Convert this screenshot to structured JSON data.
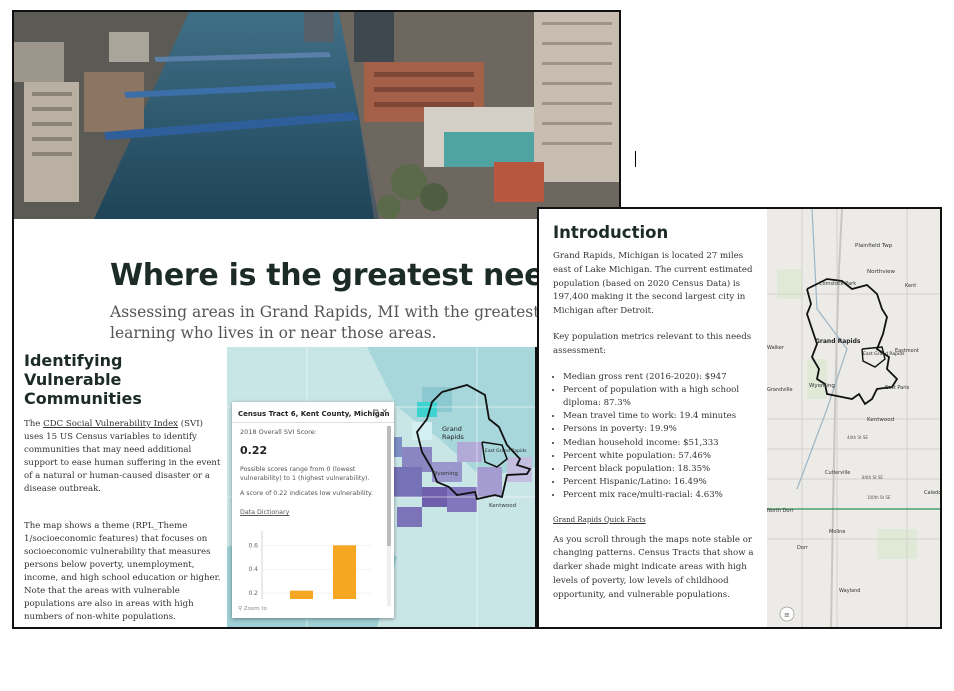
{
  "hero": {
    "title": "Where is the greatest need?",
    "subtitle": "Assessing areas in Grand Rapids, MI with the greatest need as well as learning who lives in or near those areas."
  },
  "vulnerable": {
    "title": "Identifying Vulnerable Communities",
    "para1_prefix": "The ",
    "para1_link": "CDC Social Vulnerability Index",
    "para1_rest": " (SVI) uses 15 US Census variables to identify communities that may need additional support to ease human suffering in the event of a natural or human-caused disaster or a disease outbreak.",
    "para2": "The map shows a theme (RPL_Theme 1/socioeconomic features) that focuses on socioeconomic vulnerability that measures persons below poverty, unemployment, income, and high school education or higher. Note that the areas with vulnerable populations are also in areas with high numbers of non-white populations.",
    "map_labels": {
      "grand": "Grand",
      "rapids": "Rapids",
      "wyoming": "Wyoming",
      "kentwood": "Kentwood",
      "east_grand_rapids": "East Grand Rapids"
    },
    "popup": {
      "heading": "Census Tract 6, Kent County, Michigan",
      "score_label": "2018 Overall SVI Score:",
      "score": "0.22",
      "range_text": "Possible scores range from 0 (lowest vulnerability) to 1 (highest vulnerability).",
      "low_text": "A score of 0.22 indicates low vulnerability.",
      "dictionary_link": "Data Dictionary",
      "zoom_label": "Zoom to"
    }
  },
  "chart_data": {
    "type": "bar",
    "categories": [
      "",
      ""
    ],
    "values": [
      0.22,
      0.6
    ],
    "yticks": [
      0.2,
      0.4,
      0.6
    ],
    "ylim": [
      0.15,
      0.72
    ],
    "bar_color": "#f5a623"
  },
  "intro": {
    "title": "Introduction",
    "para1": "Grand Rapids, Michigan is located 27 miles east of Lake Michigan.  The current estimated population (based on 2020 Census Data) is 197,400 making it the second largest city in Michigan after Detroit.",
    "para2": "Key population metrics relevant to this needs assessment:",
    "metrics": [
      "Median gross rent (2016-2020): $947",
      "Percent of population with a high school diploma: 87.3%",
      "Mean travel time to work: 19.4 minutes",
      "Persons in poverty: 19.9%",
      "Median household income: $51,333",
      "Percent white population: 57.46%",
      "Percent black population: 18.35%",
      "Percent Hispanic/Latino: 16.49%",
      "Percent mix race/multi-racial: 4.63%"
    ],
    "quick_facts_link": "Grand Rapids Quick Facts",
    "para3": "As you scroll through the maps note stable or changing patterns. Census Tracts that show a darker shade might indicate areas with high levels of poverty, low levels of childhood opportunity, and vulnerable populations.",
    "map_labels": {
      "plainfield": "Plainfield Twp",
      "northview": "Northview",
      "comstock": "Comstock Park",
      "kent": "Kent",
      "grand_rapids": "Grand Rapids",
      "east_gr": "East Grand Rapids",
      "eastmont": "Eastmont",
      "walker": "Walker",
      "grandville": "Grandville",
      "wyoming": "Wyoming",
      "east_paris": "East Paris",
      "kentwood": "Kentwood",
      "cutlerville": "Cutlerville",
      "caledonia": "Caledo",
      "north_dorr": "North Dorr",
      "moline": "Moline",
      "dorr": "Dorr",
      "wayland": "Wayland",
      "st_44": "44th St SE",
      "st_84": "84th St SE",
      "st_100": "100th St SE",
      "st_54": "54th St SW",
      "st_28": "28th St SE"
    }
  }
}
